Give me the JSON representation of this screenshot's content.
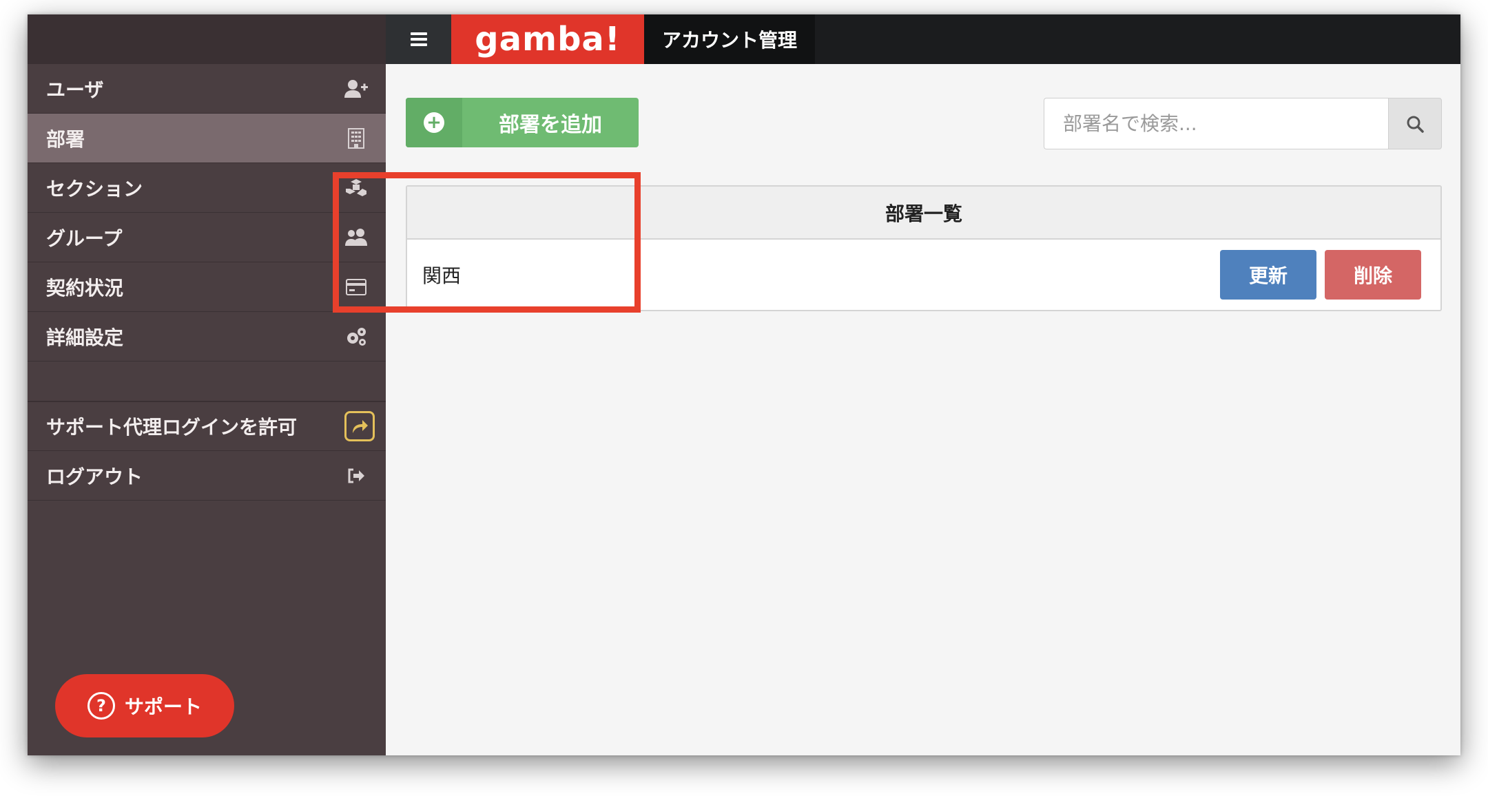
{
  "header": {
    "logo_text": "gamba!",
    "title": "アカウント管理"
  },
  "sidebar": {
    "items": [
      {
        "label": "ユーザ",
        "icon": "add-user-icon"
      },
      {
        "label": "部署",
        "icon": "building-icon",
        "active": true
      },
      {
        "label": "セクション",
        "icon": "cubes-icon"
      },
      {
        "label": "グループ",
        "icon": "users-icon"
      },
      {
        "label": "契約状況",
        "icon": "credit-card-icon"
      },
      {
        "label": "詳細設定",
        "icon": "gears-icon"
      }
    ],
    "support_proxy_label": "サポート代理ログインを許可",
    "logout_label": "ログアウト"
  },
  "support_button": {
    "label": "サポート",
    "icon_glyph": "?"
  },
  "main": {
    "add_button_label": "部署を追加",
    "search_placeholder": "部署名で検索...",
    "panel_title": "部署一覧",
    "rows": [
      {
        "name": "関西",
        "update_label": "更新",
        "delete_label": "削除"
      }
    ]
  },
  "colors": {
    "brand_red": "#e0352a",
    "sidebar_bg": "#4a3e41",
    "add_green": "#6fbb72",
    "update_blue": "#4f81bd",
    "delete_red": "#d46665",
    "highlight_red": "#e8402c"
  }
}
